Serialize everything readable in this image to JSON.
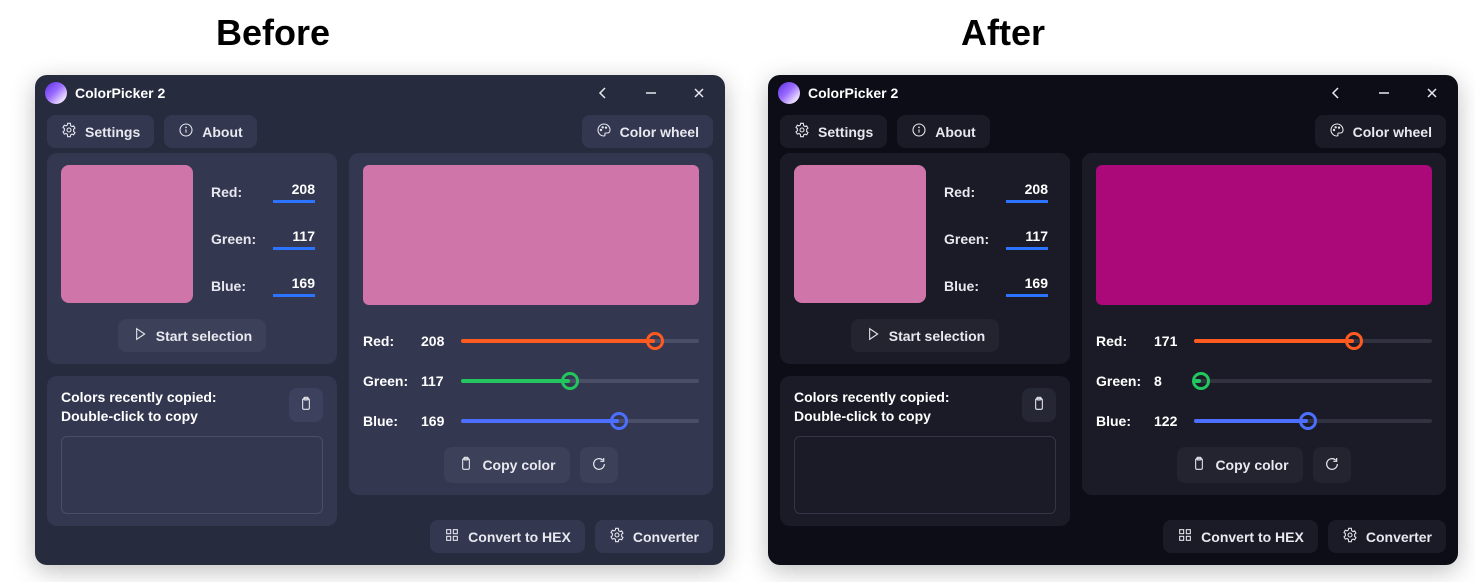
{
  "headings": {
    "before": "Before",
    "after": "After"
  },
  "app": {
    "title": "ColorPicker 2"
  },
  "toolbar": {
    "settings": "Settings",
    "about": "About",
    "colorwheel": "Color wheel"
  },
  "labels": {
    "red": "Red:",
    "green": "Green:",
    "blue": "Blue:",
    "start_selection": "Start selection",
    "recent_line1": "Colors recently copied:",
    "recent_line2": "Double-click to copy",
    "copy_color": "Copy color",
    "convert_hex": "Convert to HEX",
    "converter": "Converter"
  },
  "before": {
    "swatch_hex": "#d075a9",
    "rgb": {
      "r": 208,
      "g": 117,
      "b": 169
    },
    "preview_hex": "#d075a9",
    "slider": {
      "r": 208,
      "g": 117,
      "b": 169
    }
  },
  "after": {
    "swatch_hex": "#d075a9",
    "rgb": {
      "r": 208,
      "g": 117,
      "b": 169
    },
    "preview_hex": "#ab087a",
    "slider": {
      "r": 171,
      "g": 8,
      "b": 122
    }
  },
  "slider_colors": {
    "r": "#ff5a1f",
    "g": "#22c55e",
    "b": "#4c6fff"
  }
}
